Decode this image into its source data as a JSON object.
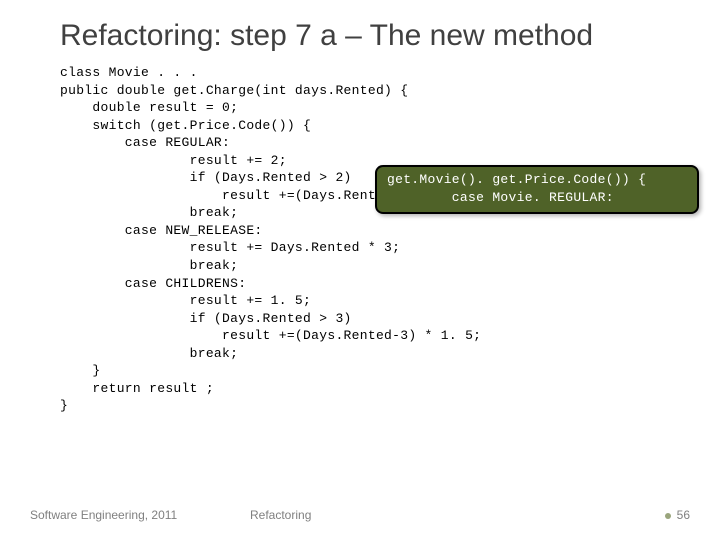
{
  "title": "Refactoring: step 7 a – The new method",
  "code": "class Movie . . .\npublic double get.Charge(int days.Rented) {\n    double result = 0;\n    switch (get.Price.Code()) {\n        case REGULAR:\n                result += 2;\n                if (Days.Rented > 2)\n                    result +=(Days.Rented-2) * 1. 5;\n                break;\n        case NEW_RELEASE:\n                result += Days.Rented * 3;\n                break;\n        case CHILDRENS:\n                result += 1. 5;\n                if (Days.Rented > 3)\n                    result +=(Days.Rented-3) * 1. 5;\n                break;\n    }\n    return result ;\n}",
  "callout": "get.Movie(). get.Price.Code()) {\n        case Movie. REGULAR:",
  "footer": {
    "left": "Software Engineering, 2011",
    "center": "Refactoring",
    "page": "56"
  }
}
